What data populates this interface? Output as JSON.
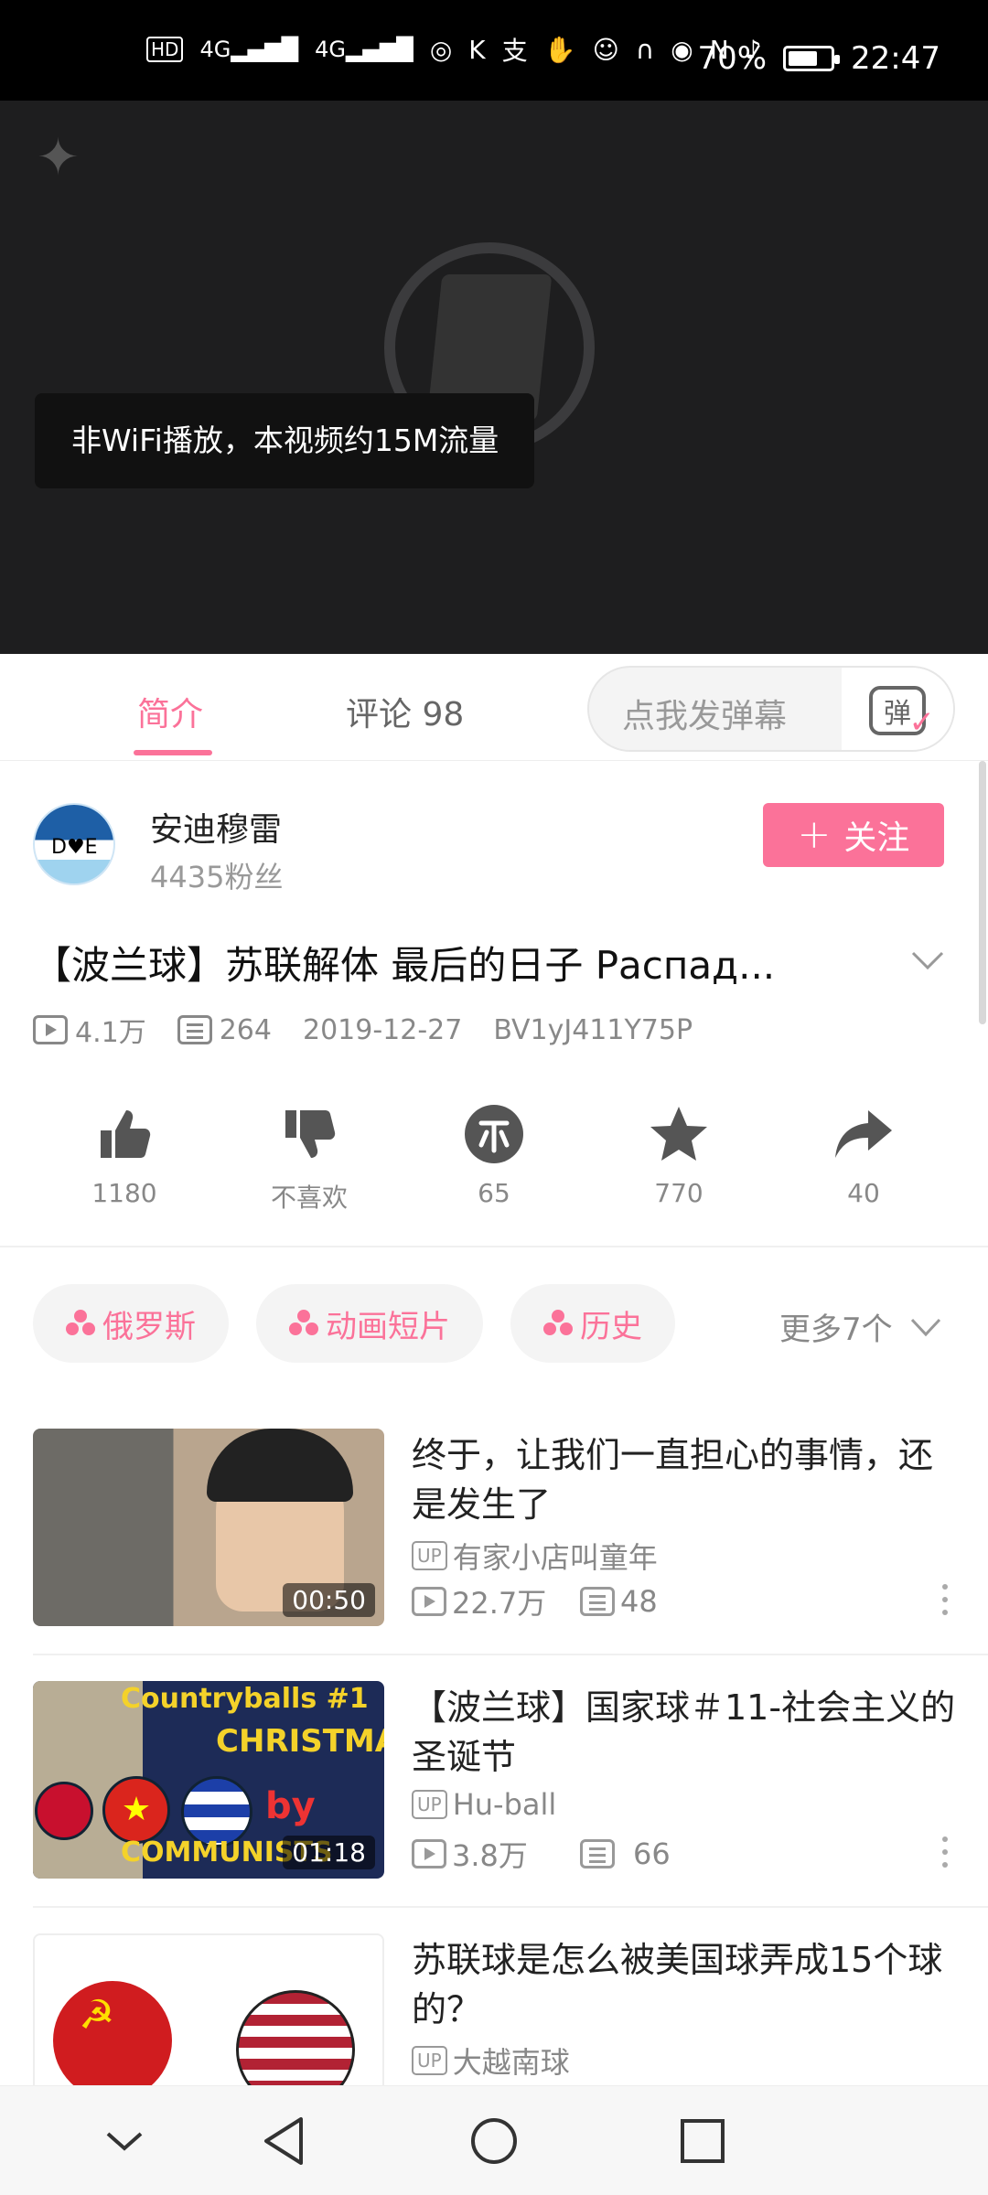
{
  "status_bar": {
    "left_icons": [
      "HD",
      "4G",
      "4G",
      "hotspot-icon",
      "k-icon",
      "pay-icon",
      "hand-icon",
      "face-icon",
      "headset-icon",
      "eye-icon",
      "nfc-icon",
      "mute-icon"
    ],
    "battery": "70%",
    "battery_level": 0.7,
    "time": "22:47"
  },
  "video": {
    "toast": "非WiFi播放，本视频约15M流量"
  },
  "tabs": {
    "intro": "简介",
    "comments": "评论 98"
  },
  "danmu": {
    "placeholder": "点我发弹幕",
    "icon_label": "弹"
  },
  "uploader": {
    "name": "安迪穆雷",
    "fans": "4435粉丝",
    "follow_label": "关注"
  },
  "video_info": {
    "title": "【波兰球】苏联解体 最后的日子 Распад...",
    "views": "4.1万",
    "danmaku": "264",
    "date": "2019-12-27",
    "bvid": "BV1yJ411Y75P"
  },
  "actions": {
    "like": "1180",
    "dislike": "不喜欢",
    "coin": "65",
    "favorite": "770",
    "share": "40"
  },
  "tags": {
    "items": [
      "俄罗斯",
      "动画短片",
      "历史"
    ],
    "more": "更多7个"
  },
  "related": [
    {
      "title": "终于，让我们一直担心的事情，还是发生了",
      "up_badge": "UP",
      "uploader": "有家小店叫童年",
      "views": "22.7万",
      "danmaku": "48",
      "duration": "00:50"
    },
    {
      "title": "【波兰球】国家球＃11-社会主义的圣诞节",
      "up_badge": "UP",
      "uploader": "Hu-ball",
      "views": "3.8万",
      "danmaku": "66",
      "duration": "01:18",
      "thumb_text_top": "Countryballs #1",
      "thumb_text_mid": "CHRISTMAS",
      "thumb_text_by": "by",
      "thumb_text_bottom": "COMMUNISTS"
    },
    {
      "title": "苏联球是怎么被美国球弄成15个球的？",
      "up_badge": "UP",
      "uploader": "大越南球"
    }
  ],
  "colors": {
    "accent": "#fb7299",
    "status_bg": "#000000",
    "video_bg": "#1e1e1f"
  }
}
